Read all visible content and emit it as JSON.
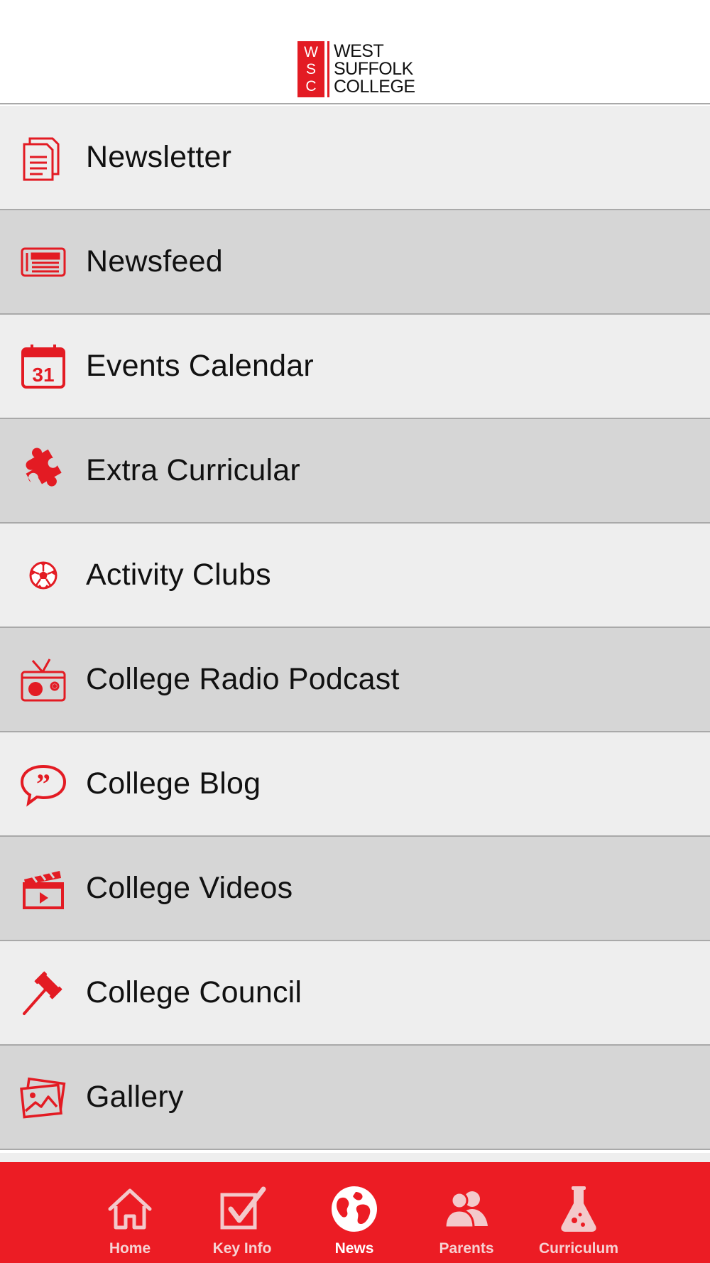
{
  "header": {
    "logo": {
      "letters": [
        "W",
        "S",
        "C"
      ],
      "words": [
        "WEST",
        "SUFFOLK",
        "COLLEGE"
      ]
    }
  },
  "menu": {
    "items": [
      {
        "label": "Newsletter",
        "icon": "newsletter-icon"
      },
      {
        "label": "Newsfeed",
        "icon": "newspaper-icon"
      },
      {
        "label": "Events Calendar",
        "icon": "calendar-icon",
        "icon_text": "31"
      },
      {
        "label": "Extra Curricular",
        "icon": "puzzle-icon"
      },
      {
        "label": "Activity Clubs",
        "icon": "football-icon"
      },
      {
        "label": "College Radio Podcast",
        "icon": "radio-icon"
      },
      {
        "label": "College Blog",
        "icon": "speech-bubble-icon"
      },
      {
        "label": "College Videos",
        "icon": "clapperboard-icon"
      },
      {
        "label": "College Council",
        "icon": "gavel-icon"
      },
      {
        "label": "Gallery",
        "icon": "photos-icon"
      }
    ]
  },
  "tabbar": {
    "tabs": [
      {
        "label": "Home",
        "icon": "home-icon"
      },
      {
        "label": "Key Info",
        "icon": "checkbox-icon"
      },
      {
        "label": "News",
        "icon": "globe-icon",
        "active": true
      },
      {
        "label": "Parents",
        "icon": "people-icon"
      },
      {
        "label": "Curriculum",
        "icon": "flask-icon"
      }
    ]
  },
  "colors": {
    "accent": "#ec1c24",
    "row_light": "#eeeeee",
    "row_dark": "#d6d6d6",
    "divider": "#a9a9a9"
  }
}
